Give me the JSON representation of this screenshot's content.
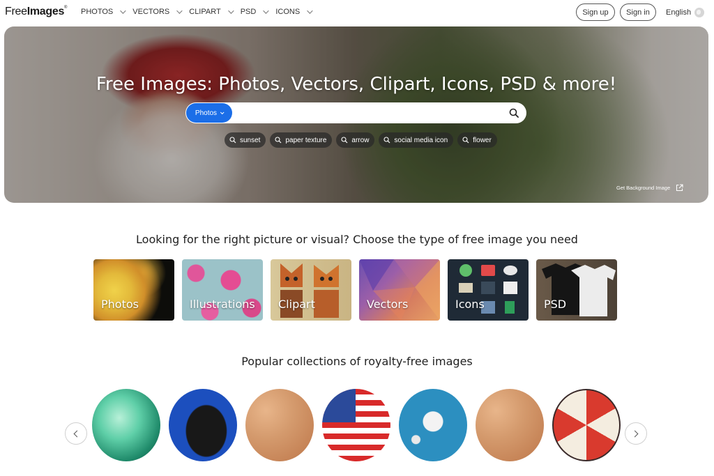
{
  "header": {
    "logo": {
      "prefix": "Free",
      "bold": "Images",
      "mark": "®"
    },
    "nav": [
      {
        "label": "PHOTOS"
      },
      {
        "label": "VECTORS"
      },
      {
        "label": "CLIPART"
      },
      {
        "label": "PSD"
      },
      {
        "label": "ICONS"
      }
    ],
    "signup_label": "Sign up",
    "signin_label": "Sign in",
    "language": "English"
  },
  "hero": {
    "title": "Free Images: Photos, Vectors, Clipart, Icons, PSD & more!",
    "type_selector": "Photos",
    "search_placeholder": "",
    "chips": [
      {
        "label": "sunset"
      },
      {
        "label": "paper texture"
      },
      {
        "label": "arrow"
      },
      {
        "label": "social media icon"
      },
      {
        "label": "flower"
      }
    ],
    "background_link": "Get Background Image"
  },
  "types_section": {
    "heading": "Looking for the right picture or visual? Choose the type of free image you need",
    "cards": [
      {
        "label": "Photos"
      },
      {
        "label": "Illustrations"
      },
      {
        "label": "Clipart"
      },
      {
        "label": "Vectors"
      },
      {
        "label": "Icons"
      },
      {
        "label": "PSD"
      }
    ]
  },
  "collections_section": {
    "heading": "Popular collections of royalty-free images"
  },
  "colors": {
    "accent": "#1b6ee8",
    "chip_bg": "#282828",
    "text": "#222222"
  }
}
